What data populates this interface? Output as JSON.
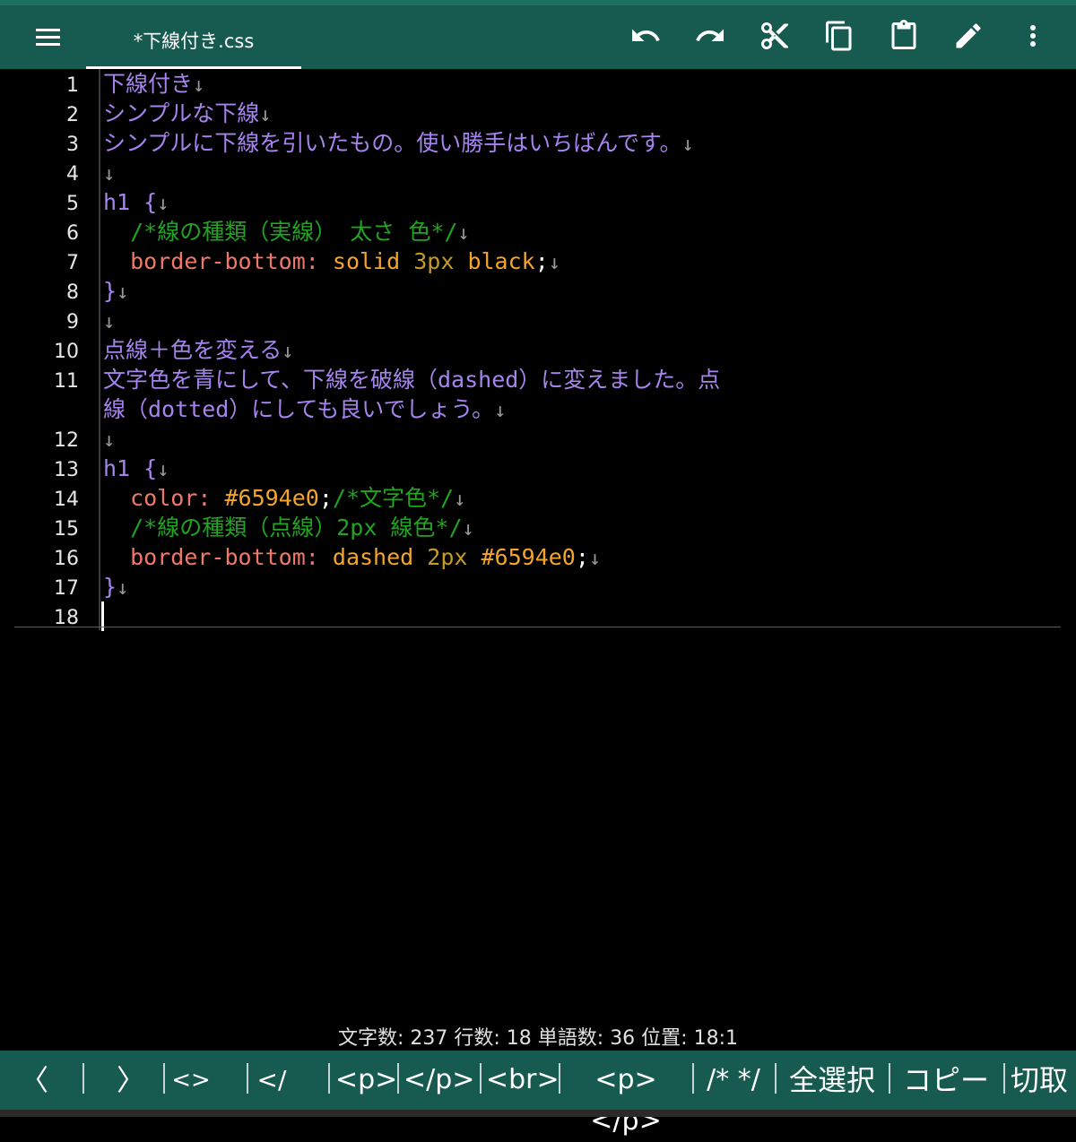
{
  "toolbar": {
    "tab_title": "*下線付き.css",
    "icons": [
      "menu-icon",
      "undo-icon",
      "redo-icon",
      "cut-icon",
      "copy-icon",
      "paste-icon",
      "edit-icon",
      "more-vert-icon"
    ]
  },
  "editor": {
    "line_numbers": [
      "1",
      "2",
      "3",
      "4",
      "5",
      "6",
      "7",
      "8",
      "9",
      "10",
      "11",
      "12",
      "13",
      "14",
      "15",
      "16",
      "17",
      "18"
    ],
    "lines": [
      [
        "下線付き"
      ],
      [
        "シンプルな下線"
      ],
      [
        "シンプルに下線を引いたもの。使い勝手はいちばんです。"
      ],
      [
        ""
      ],
      [
        "h1 {"
      ],
      [
        "  ",
        "/*線の種類（実線） 太さ 色*/"
      ],
      [
        "  ",
        "border-bottom:",
        " ",
        "solid",
        " ",
        "3px",
        " ",
        "black",
        ";"
      ],
      [
        "}"
      ],
      [
        ""
      ],
      [
        "点線＋色を変える"
      ],
      [
        "文字色を青にして、下線を破線（dashed）に変えました。点",
        "線（dotted）にしても良いでしょう。"
      ],
      [
        ""
      ],
      [
        "h1 {"
      ],
      [
        "  ",
        "color:",
        " ",
        "#6594e0",
        ";",
        "/*文字色*/"
      ],
      [
        "  ",
        "/*線の種類（点線）2px 線色*/"
      ],
      [
        "  ",
        "border-bottom:",
        " ",
        "dashed",
        " ",
        "2px",
        " ",
        "#6594e0",
        ";"
      ],
      [
        "}"
      ],
      [
        ""
      ]
    ],
    "newline_mark": "↓"
  },
  "status_bar": {
    "text": "文字数: 237  行数: 18  単語数: 36  位置: 18:1"
  },
  "quick_keys": [
    "〈",
    "〉",
    "<>",
    "</",
    "<p>",
    "</p>",
    "<br>",
    "<p></p>",
    "/* */",
    "全選択",
    "コピー",
    "切取"
  ],
  "colors": {
    "toolbar_bg": "#175a4f",
    "editor_bg": "#000000",
    "text_default": "#a684ee",
    "css_property": "#f0786a",
    "css_value": "#f4a52a",
    "css_number": "#c59b24",
    "css_comment": "#21a521",
    "current_line_marker": "#c8302a"
  }
}
